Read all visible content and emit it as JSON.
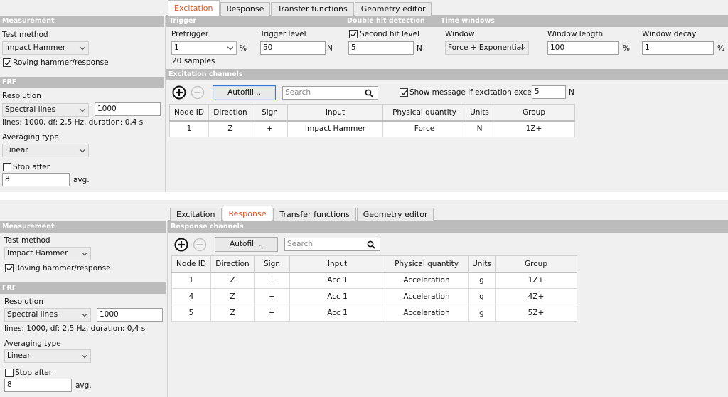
{
  "panel_a": {
    "tabs": [
      "Excitation",
      "Response",
      "Transfer functions",
      "Geometry editor"
    ],
    "active_tab": "Excitation",
    "left": {
      "measurement_header": "Measurement",
      "test_method_label": "Test method",
      "test_method_value": "Impact Hammer",
      "roving_label": "Roving hammer/response",
      "roving_checked": true,
      "frf_header": "FRF",
      "resolution_label": "Resolution",
      "resolution_mode": "Spectral lines",
      "resolution_value": "1000",
      "resolution_info": "lines: 1000, df: 2,5 Hz, duration: 0,4 s",
      "averaging_label": "Averaging type",
      "averaging_value": "Linear",
      "stop_after_label": "Stop after",
      "stop_after_checked": false,
      "stop_after_value": "8",
      "avg_unit": "avg."
    },
    "trigger": {
      "header": "Trigger",
      "pretrigger_label": "Pretrigger",
      "pretrigger_value": "1",
      "pretrigger_unit": "%",
      "samples_text": "20 samples",
      "trigger_level_label": "Trigger level",
      "trigger_level_value": "50",
      "trigger_level_unit": "N"
    },
    "double_hit": {
      "header": "Double hit detection",
      "second_hit_label": "Second hit level",
      "second_hit_checked": true,
      "second_hit_value": "5",
      "second_hit_unit": "N"
    },
    "time_windows": {
      "header": "Time windows",
      "window_label": "Window",
      "window_value": "Force + Exponential",
      "window_length_label": "Window length",
      "window_length_value": "100",
      "window_length_unit": "%",
      "window_decay_label": "Window decay",
      "window_decay_value": "1",
      "window_decay_unit": "%"
    },
    "channels": {
      "header": "Excitation channels",
      "autofill_label": "Autofill...",
      "search_placeholder": "Search",
      "show_message_label": "Show message if excitation exceeds",
      "show_message_checked": true,
      "show_message_value": "5",
      "show_message_unit": "N",
      "columns": [
        "Node ID",
        "Direction",
        "Sign",
        "Input",
        "Physical quantity",
        "Units",
        "Group"
      ],
      "rows": [
        [
          "1",
          "Z",
          "+",
          "Impact Hammer",
          "Force",
          "N",
          "1Z+"
        ]
      ]
    }
  },
  "panel_b": {
    "tabs": [
      "Excitation",
      "Response",
      "Transfer functions",
      "Geometry editor"
    ],
    "active_tab": "Response",
    "left": {
      "measurement_header": "Measurement",
      "test_method_label": "Test method",
      "test_method_value": "Impact Hammer",
      "roving_label": "Roving hammer/response",
      "roving_checked": true,
      "frf_header": "FRF",
      "resolution_label": "Resolution",
      "resolution_mode": "Spectral lines",
      "resolution_value": "1000",
      "resolution_info": "lines: 1000, df: 2,5 Hz, duration: 0,4 s",
      "averaging_label": "Averaging type",
      "averaging_value": "Linear",
      "stop_after_label": "Stop after",
      "stop_after_checked": false,
      "stop_after_value": "8",
      "avg_unit": "avg."
    },
    "channels": {
      "header": "Response channels",
      "autofill_label": "Autofill...",
      "search_placeholder": "Search",
      "columns": [
        "Node ID",
        "Direction",
        "Sign",
        "Input",
        "Physical quantity",
        "Units",
        "Group"
      ],
      "rows": [
        [
          "1",
          "Z",
          "+",
          "Acc 1",
          "Acceleration",
          "g",
          "1Z+"
        ],
        [
          "4",
          "Z",
          "+",
          "Acc 1",
          "Acceleration",
          "g",
          "4Z+"
        ],
        [
          "5",
          "Z",
          "+",
          "Acc 1",
          "Acceleration",
          "g",
          "5Z+"
        ]
      ]
    }
  },
  "colors": {
    "active_tab_text": "#d4582c",
    "section_header_bg": "#bcbcbc",
    "panel_bg": "#f0f0f0",
    "focus_border": "#3a77d4"
  },
  "icons": [
    "add-icon",
    "remove-icon",
    "search-icon",
    "check-icon",
    "chevron-down-icon"
  ]
}
